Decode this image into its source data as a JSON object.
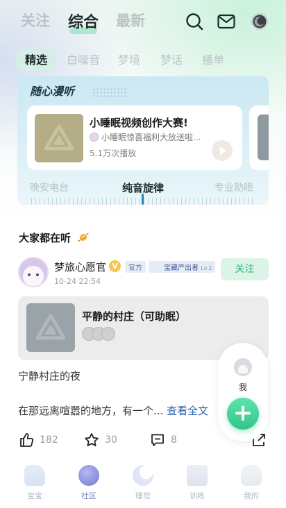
{
  "top_tabs": [
    "关注",
    "综合",
    "最新"
  ],
  "sub_tabs": [
    "精选",
    "白噪音",
    "梦境",
    "梦话",
    "播单"
  ],
  "radio": {
    "title": "随心漫听",
    "episode": {
      "title": "小睡眠视频创作大赛!",
      "subtitle": "小睡眠惊喜福利大放送啦...",
      "plays": "5.1万次播放"
    },
    "channels": [
      "晚安电台",
      "纯音旋律",
      "专业助眠"
    ]
  },
  "section_title": "大家都在听",
  "post": {
    "username": "梦旅心愿官",
    "badge_v": "V",
    "tag_official": "官方",
    "tag_producer": "宝藏产出者",
    "tag_producer_level": "Lv.2",
    "time": "10-24 22:54",
    "follow_label": "关注",
    "track_title": "平静的村庄（可助眠）",
    "text_line1": "宁静村庄的夜",
    "text_line2": "在那远离喧嚣的地方，有一个...",
    "read_more": "查看全文",
    "likes": "182",
    "favorites": "30",
    "comments": "8"
  },
  "fab": {
    "me_label": "我",
    "plus": "+"
  },
  "bottom_nav": [
    "宝宝",
    "社区",
    "睡觉",
    "训练",
    "我的"
  ],
  "colors": {
    "accent": "#31c68a",
    "nav_active": "#7b80c9",
    "link": "#2a64b0"
  }
}
